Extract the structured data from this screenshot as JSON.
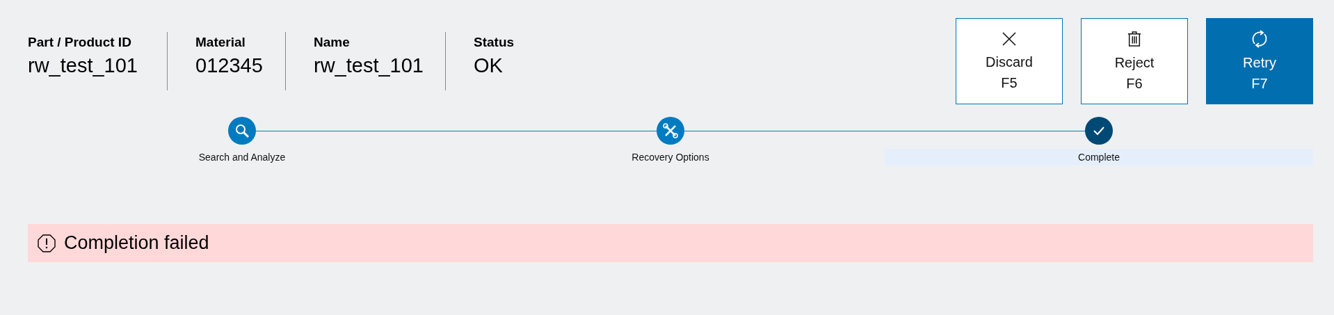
{
  "info_fields": [
    {
      "label": "Part / Product ID",
      "value": "rw_test_101"
    },
    {
      "label": "Material",
      "value": "012345"
    },
    {
      "label": "Name",
      "value": "rw_test_101"
    },
    {
      "label": "Status",
      "value": "OK"
    }
  ],
  "actions": [
    {
      "kind": "discard",
      "label": "Discard",
      "shortcut": "F5",
      "primary": false
    },
    {
      "kind": "reject",
      "label": "Reject",
      "shortcut": "F6",
      "primary": false
    },
    {
      "kind": "retry",
      "label": "Retry",
      "shortcut": "F7",
      "primary": true
    }
  ],
  "steps": [
    {
      "kind": "search",
      "label": "Search and Analyze",
      "selected": false
    },
    {
      "kind": "tools",
      "label": "Recovery Options",
      "selected": false
    },
    {
      "kind": "check",
      "label": "Complete",
      "selected": true
    }
  ],
  "alert": {
    "text": "Completion failed"
  }
}
